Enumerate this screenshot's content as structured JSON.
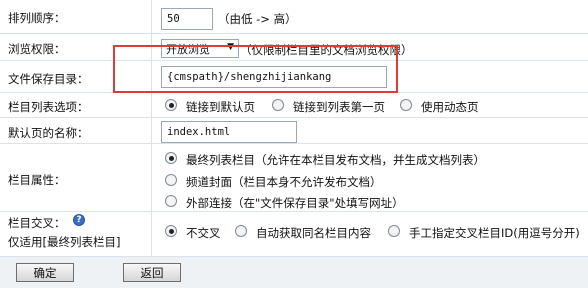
{
  "sort_order": {
    "label": "排列顺序：",
    "value": "50",
    "hint": "（由低 -> 高）"
  },
  "browse_permission": {
    "label": "浏览权限：",
    "selected": "开放浏览",
    "hint": "（仅限制栏目里的文档浏览权限）"
  },
  "save_dir": {
    "label": "文件保存目录：",
    "value": "{cmspath}/shengzhijiankang"
  },
  "list_option": {
    "label": "栏目列表选项：",
    "options": [
      "链接到默认页",
      "链接到列表第一页",
      "使用动态页"
    ]
  },
  "default_page": {
    "label": "默认页的名称：",
    "value": "index.html"
  },
  "column_attr": {
    "label": "栏目属性：",
    "options": [
      "最终列表栏目（允许在本栏目发布文档，并生成文档列表）",
      "频道封面（栏目本身不允许发布文档）",
      "外部连接（在\"文件保存目录\"处填写网址）"
    ]
  },
  "cross": {
    "label": "栏目交叉：",
    "sublabel": "仅适用[最终列表栏目]",
    "help_icon": "help-icon",
    "options": [
      "不交叉",
      "自动获取同名栏目内容",
      "手工指定交叉栏目ID(用逗号分开)"
    ]
  },
  "buttons": {
    "confirm": "确定",
    "back": "返回"
  }
}
